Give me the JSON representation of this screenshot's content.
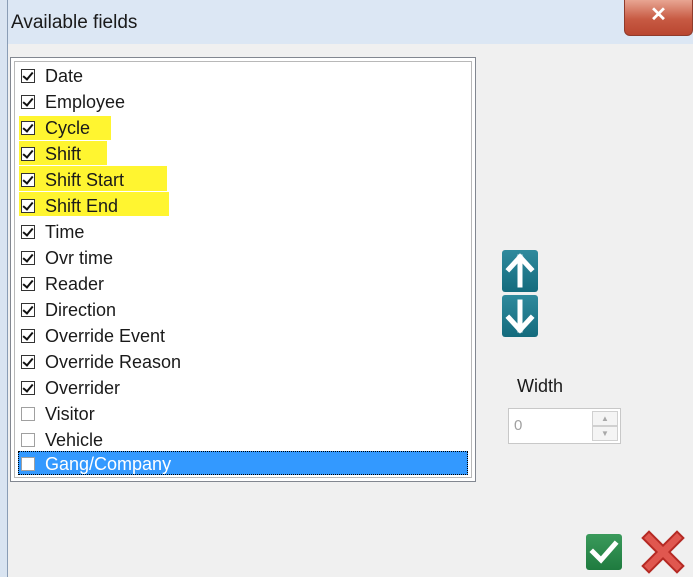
{
  "window": {
    "title": "Available fields",
    "close_glyph": "✕"
  },
  "fields": [
    {
      "label": "Date",
      "checked": true,
      "highlighted": false,
      "selected": false
    },
    {
      "label": "Employee",
      "checked": true,
      "highlighted": false,
      "selected": false
    },
    {
      "label": "Cycle",
      "checked": true,
      "highlighted": true,
      "selected": false
    },
    {
      "label": "Shift",
      "checked": true,
      "highlighted": true,
      "selected": false
    },
    {
      "label": "Shift Start",
      "checked": true,
      "highlighted": true,
      "selected": false
    },
    {
      "label": "Shift End",
      "checked": true,
      "highlighted": true,
      "selected": false
    },
    {
      "label": "Time",
      "checked": true,
      "highlighted": false,
      "selected": false
    },
    {
      "label": "Ovr time",
      "checked": true,
      "highlighted": false,
      "selected": false
    },
    {
      "label": "Reader",
      "checked": true,
      "highlighted": false,
      "selected": false
    },
    {
      "label": "Direction",
      "checked": true,
      "highlighted": false,
      "selected": false
    },
    {
      "label": "Override Event",
      "checked": true,
      "highlighted": false,
      "selected": false
    },
    {
      "label": "Override Reason",
      "checked": true,
      "highlighted": false,
      "selected": false
    },
    {
      "label": "Overrider",
      "checked": true,
      "highlighted": false,
      "selected": false
    },
    {
      "label": "Visitor",
      "checked": false,
      "highlighted": false,
      "selected": false
    },
    {
      "label": "Vehicle",
      "checked": false,
      "highlighted": false,
      "selected": false
    },
    {
      "label": "Gang/Company",
      "checked": false,
      "highlighted": false,
      "selected": true
    }
  ],
  "width": {
    "label": "Width",
    "value": "0"
  },
  "icons": {
    "move_up": "arrow-up-icon",
    "move_down": "arrow-down-icon",
    "ok": "checkmark-icon",
    "cancel": "x-icon"
  },
  "colors": {
    "highlight": "#fff530",
    "selection": "#3399ff",
    "arrow_button": "#1c7689",
    "ok_button": "#267f45",
    "cancel_button": "#d9534f"
  }
}
